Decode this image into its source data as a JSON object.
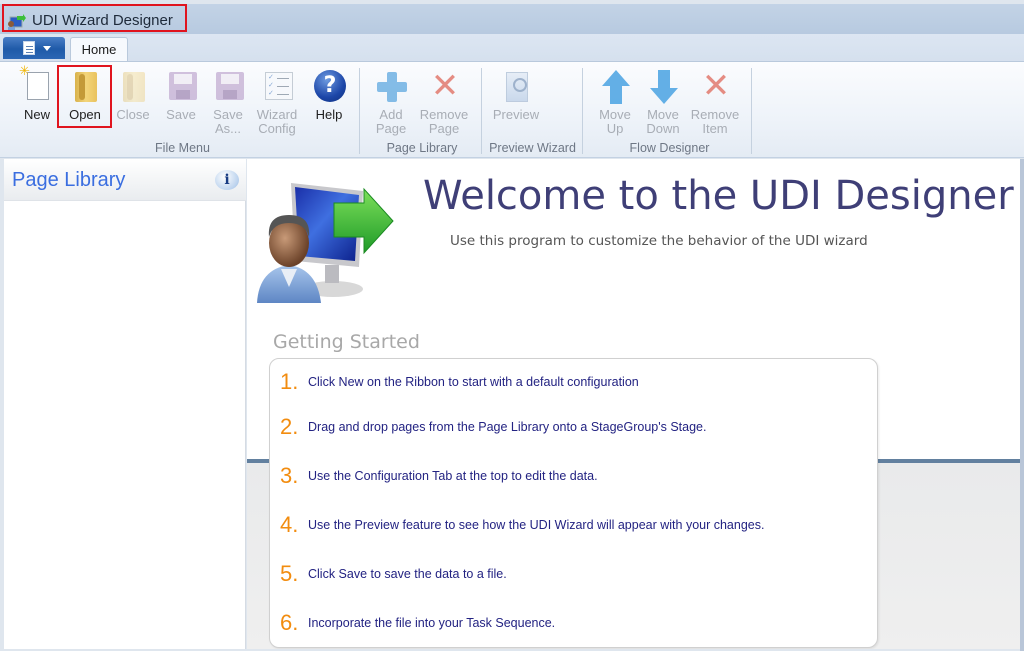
{
  "window": {
    "title": "UDI Wizard Designer",
    "app_icon": "udi-app-icon"
  },
  "tabs": {
    "app_menu_icon": "document-icon",
    "home": "Home"
  },
  "ribbon": {
    "file_menu": {
      "label": "File Menu",
      "buttons": [
        {
          "label": "New",
          "icon": "new-document-icon",
          "enabled": true
        },
        {
          "label": "Open",
          "icon": "folder-open-icon",
          "enabled": true,
          "highlighted": true
        },
        {
          "label": "Close",
          "icon": "folder-close-icon",
          "enabled": false
        },
        {
          "label": "Save",
          "icon": "floppy-disk-icon",
          "enabled": false
        },
        {
          "label": "Save As...",
          "line1": "Save",
          "line2": "As...",
          "icon": "floppy-disk-pen-icon",
          "enabled": false
        },
        {
          "label": "Wizard Config",
          "line1": "Wizard",
          "line2": "Config",
          "icon": "checklist-icon",
          "enabled": false
        },
        {
          "label": "Help",
          "icon": "help-icon",
          "enabled": true
        }
      ]
    },
    "page_library": {
      "label": "Page Library",
      "buttons": [
        {
          "label": "Add Page",
          "line1": "Add",
          "line2": "Page",
          "icon": "plus-icon",
          "enabled": false
        },
        {
          "label": "Remove Page",
          "line1": "Remove",
          "line2": "Page",
          "icon": "x-icon",
          "enabled": false
        }
      ]
    },
    "preview_wizard": {
      "label": "Preview Wizard",
      "buttons": [
        {
          "label": "Preview",
          "icon": "preview-magnifier-icon",
          "enabled": false
        }
      ]
    },
    "flow_designer": {
      "label": "Flow Designer",
      "buttons": [
        {
          "label": "Move Up",
          "line1": "Move",
          "line2": "Up",
          "icon": "arrow-up-icon",
          "enabled": false
        },
        {
          "label": "Move Down",
          "line1": "Move",
          "line2": "Down",
          "icon": "arrow-down-icon",
          "enabled": false
        },
        {
          "label": "Remove Item",
          "line1": "Remove",
          "line2": "Item",
          "icon": "x-icon",
          "enabled": false
        }
      ]
    }
  },
  "left_pane": {
    "title": "Page Library",
    "info_icon": "i"
  },
  "main": {
    "welcome_title": "Welcome to the UDI Designer",
    "welcome_subtitle": "Use this program to customize the behavior of the UDI wizard",
    "getting_started_title": "Getting Started",
    "steps": [
      {
        "num": "1.",
        "text": "Click New on the Ribbon to start with a default configuration"
      },
      {
        "num": "2.",
        "text": "Drag and drop pages from the Page Library onto a StageGroup's Stage."
      },
      {
        "num": "3.",
        "text": "Use the Configuration Tab at the top to edit the data."
      },
      {
        "num": "4.",
        "text": "Use the Preview feature to see how the UDI Wizard will appear with your changes."
      },
      {
        "num": "5.",
        "text": "Click Save to save the data to a file."
      },
      {
        "num": "6.",
        "text": "Incorporate the file into your Task Sequence."
      }
    ]
  },
  "colors": {
    "highlight_outline": "#e0141e",
    "step_number": "#f28c0f",
    "step_text": "#232382",
    "welcome_title": "#3f3f77",
    "page_library_title": "#3a6ee0"
  }
}
